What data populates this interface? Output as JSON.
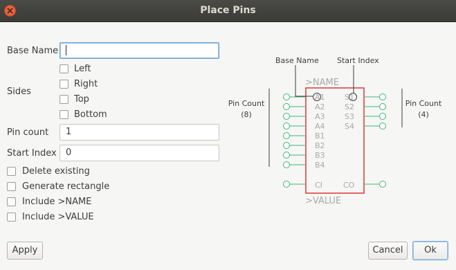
{
  "window": {
    "title": "Place Pins"
  },
  "form": {
    "base_name_label": "Base Name",
    "base_name_value": "",
    "sides_label": "Sides",
    "sides": [
      "Left",
      "Right",
      "Top",
      "Bottom"
    ],
    "pin_count_label": "Pin count",
    "pin_count_value": "1",
    "start_index_label": "Start Index",
    "start_index_value": "0",
    "options": [
      "Delete existing",
      "Generate rectangle",
      "Include >NAME",
      "Include >VALUE"
    ]
  },
  "preview": {
    "base_name": "Base Name",
    "start_index": "Start Index",
    "name_text": ">NAME",
    "value_text": ">VALUE",
    "pin_count_left_label": "Pin Count",
    "pin_count_left_value": "(8)",
    "pin_count_right_label": "Pin Count",
    "pin_count_right_value": "(4)",
    "left_pins": [
      "A1",
      "A2",
      "A3",
      "A4",
      "B1",
      "B2",
      "B3",
      "B4"
    ],
    "right_pins": [
      "S1",
      "S2",
      "S3",
      "S4"
    ],
    "ci": "CI",
    "co": "CO",
    "colors": {
      "rect": "#d9383a",
      "pin": "#3fb573",
      "pin_text": "#a8a8a8",
      "note": "#3c3c3c"
    }
  },
  "buttons": {
    "apply": "Apply",
    "cancel": "Cancel",
    "ok": "Ok"
  }
}
